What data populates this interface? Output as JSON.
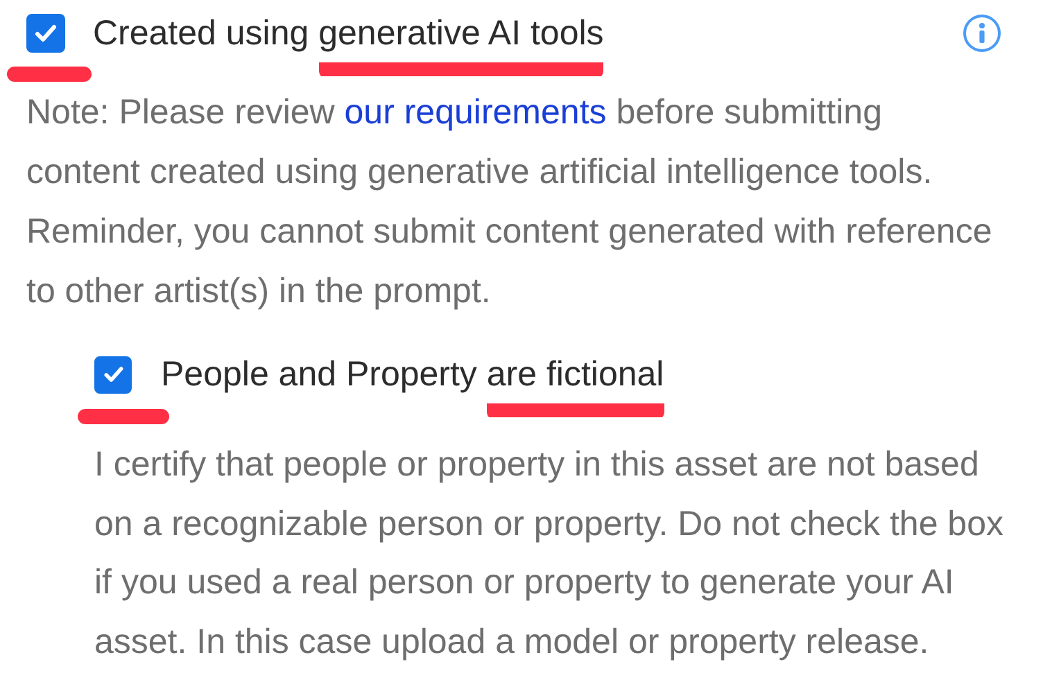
{
  "options": [
    {
      "checked": true,
      "checkbox_underlined": true,
      "info": true,
      "label": [
        {
          "text": "Created using ",
          "underlined": false
        },
        {
          "text": "generative AI tools",
          "underlined": true
        }
      ],
      "note": [
        {
          "text": "Note: Please review ",
          "link": false
        },
        {
          "text": "our requirements",
          "link": true
        },
        {
          "text": " before submitting content created using generative artificial intelligence tools. Reminder, you cannot submit content generated with reference to other artist(s) in the prompt.",
          "link": false
        }
      ],
      "children": [
        {
          "checked": true,
          "checkbox_underlined": true,
          "label": [
            {
              "text": "People and Property ",
              "underlined": false
            },
            {
              "text": "are fictional",
              "underlined": true
            }
          ],
          "note": [
            {
              "text": "I certify that people or property in this asset are not based on a recognizable person or property. Do not check the box if you used a real person or property to generate your AI asset. In this case upload a model or property release.",
              "link": false
            }
          ]
        }
      ]
    }
  ]
}
